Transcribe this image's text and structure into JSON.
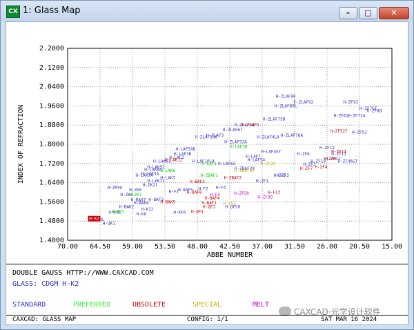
{
  "window": {
    "icon_text": "CX",
    "title": "1: Glass Map",
    "minimize_glyph": "–",
    "maximize_glyph": "□",
    "close_glyph": "✕"
  },
  "chart_data": {
    "type": "scatter",
    "xlabel": "ABBE NUMBER",
    "ylabel": "INDEX OF REFRACTION",
    "xlim": [
      70.0,
      15.0
    ],
    "ylim": [
      1.4,
      2.2
    ],
    "x_ticks": [
      "70.00",
      "64.50",
      "59.00",
      "53.50",
      "48.00",
      "42.50",
      "37.00",
      "31.50",
      "26.00",
      "20.50",
      "15.00"
    ],
    "y_ticks": [
      "2.2000",
      "2.1200",
      "2.0400",
      "1.9600",
      "1.8800",
      "1.8000",
      "1.7200",
      "1.6400",
      "1.5600",
      "1.4800",
      "1.4000"
    ],
    "grid": true,
    "series": [
      {
        "name": "STANDARD",
        "color": "#3333cc",
        "points": [
          {
            "label": "H-ZF62",
            "x": 23.6,
            "y": 1.92
          },
          {
            "label": "H-ZF72A",
            "x": 21.0,
            "y": 1.92
          },
          {
            "label": "H-ZF7GT",
            "x": 19.0,
            "y": 1.95
          },
          {
            "label": "H-ZF88",
            "x": 18.0,
            "y": 1.94
          },
          {
            "label": "E-ZLAF92",
            "x": 30.0,
            "y": 1.975
          },
          {
            "label": "H-ZLAF89L",
            "x": 33.0,
            "y": 1.96
          },
          {
            "label": "H-ZLAF75B",
            "x": 35.0,
            "y": 1.905
          },
          {
            "label": "H-ZLAF68",
            "x": 40.0,
            "y": 1.88
          },
          {
            "label": "H-ZLAF67",
            "x": 42.0,
            "y": 1.86
          },
          {
            "label": "H-ZLAF3",
            "x": 45.0,
            "y": 1.838
          },
          {
            "label": "H-ZLAF53A",
            "x": 46.5,
            "y": 1.83
          },
          {
            "label": "H-ZLAF76A",
            "x": 32.0,
            "y": 1.838
          },
          {
            "label": "H-ZLAF4LA",
            "x": 36.0,
            "y": 1.83
          },
          {
            "label": "H-ZLAF52A",
            "x": 41.5,
            "y": 1.81
          },
          {
            "label": "H-LAF4GT",
            "x": 35.5,
            "y": 1.77
          },
          {
            "label": "H-LAF7",
            "x": 38.5,
            "y": 1.75
          },
          {
            "label": "H-LAF50B",
            "x": 50.0,
            "y": 1.78
          },
          {
            "label": "H-LAF3B",
            "x": 50.5,
            "y": 1.76
          },
          {
            "label": "H-LAF2",
            "x": 51.5,
            "y": 1.745
          },
          {
            "label": "H-LAF10LA",
            "x": 47.0,
            "y": 1.73
          },
          {
            "label": "H-LAK61",
            "x": 54.0,
            "y": 1.73
          },
          {
            "label": "H-LAK52",
            "x": 55.0,
            "y": 1.705
          },
          {
            "label": "H-LAK8A",
            "x": 55.5,
            "y": 1.695
          },
          {
            "label": "H-LAK7A",
            "x": 57.0,
            "y": 1.67
          },
          {
            "label": "H-LAK5A",
            "x": 56.0,
            "y": 1.678
          },
          {
            "label": "H-LAK3",
            "x": 53.0,
            "y": 1.66
          },
          {
            "label": "H-LAK11",
            "x": 55.0,
            "y": 1.648
          },
          {
            "label": "H-LAF62",
            "x": 43.0,
            "y": 1.72
          },
          {
            "label": "H-LAF54",
            "x": 38.0,
            "y": 1.735
          },
          {
            "label": "H-BAF5",
            "x": 50.0,
            "y": 1.61
          },
          {
            "label": "H-ZBAF20",
            "x": 40.0,
            "y": 1.7
          },
          {
            "label": "H-ZF5",
            "x": 34.0,
            "y": 1.67
          },
          {
            "label": "H-ZF6",
            "x": 30.0,
            "y": 1.76
          },
          {
            "label": "H-ZF11",
            "x": 24.0,
            "y": 1.76
          },
          {
            "label": "H-ZF12",
            "x": 25.0,
            "y": 1.74
          },
          {
            "label": "H-ZF10",
            "x": 27.5,
            "y": 1.73
          },
          {
            "label": "H-ZF3",
            "x": 29.0,
            "y": 1.717
          },
          {
            "label": "H-ZF2",
            "x": 33.5,
            "y": 1.67
          },
          {
            "label": "H-ZF1",
            "x": 37.0,
            "y": 1.647
          },
          {
            "label": "H-F4",
            "x": 44.0,
            "y": 1.62
          },
          {
            "label": "H-F2",
            "x": 47.0,
            "y": 1.615
          },
          {
            "label": "H-F1",
            "x": 52.0,
            "y": 1.603
          },
          {
            "label": "H-BAF3",
            "x": 55.0,
            "y": 1.57
          },
          {
            "label": "H-BAK7",
            "x": 58.0,
            "y": 1.568
          },
          {
            "label": "H-BAK8",
            "x": 57.5,
            "y": 1.555
          },
          {
            "label": "H-BAK2",
            "x": 60.0,
            "y": 1.54
          },
          {
            "label": "H-ZK9A",
            "x": 62.0,
            "y": 1.62
          },
          {
            "label": "H-ZK3",
            "x": 60.0,
            "y": 1.59
          },
          {
            "label": "H-ZK6",
            "x": 58.5,
            "y": 1.61
          },
          {
            "label": "H-ZK21",
            "x": 56.0,
            "y": 1.63
          },
          {
            "label": "H-QK3L",
            "x": 65.0,
            "y": 1.487
          },
          {
            "label": "H-QK1",
            "x": 63.0,
            "y": 1.47
          },
          {
            "label": "H-K9L",
            "x": 62.0,
            "y": 1.516
          },
          {
            "label": "H-K12",
            "x": 56.5,
            "y": 1.53
          },
          {
            "label": "H-K8",
            "x": 57.5,
            "y": 1.51
          },
          {
            "label": "H-KF6",
            "x": 51.0,
            "y": 1.517
          },
          {
            "label": "H-QF50",
            "x": 42.0,
            "y": 1.54
          },
          {
            "label": "H-ZF52",
            "x": 20.5,
            "y": 1.85
          },
          {
            "label": "H-ZF4AGT",
            "x": 22.5,
            "y": 1.73
          },
          {
            "label": "H-ZF13",
            "x": 26.0,
            "y": 1.785
          },
          {
            "label": "H-ZLAF90",
            "x": 33.0,
            "y": 2.0
          },
          {
            "label": "H-ZF93",
            "x": 22.0,
            "y": 1.975
          }
        ]
      },
      {
        "name": "PREFERRED",
        "color": "#00cc00",
        "points": [
          {
            "label": "H-ZK7",
            "x": 58.5,
            "y": 1.59
          },
          {
            "label": "H-LAF1",
            "x": 46.0,
            "y": 1.72
          },
          {
            "label": "H-LAK6",
            "x": 53.0,
            "y": 1.69
          },
          {
            "label": "H-LAF3B",
            "x": 41.0,
            "y": 1.79
          },
          {
            "label": "H-ZBAF1",
            "x": 46.0,
            "y": 1.67
          },
          {
            "label": "H-QK3",
            "x": 61.5,
            "y": 1.52
          }
        ]
      },
      {
        "name": "OBSOLETE",
        "color": "#cc0000",
        "points": [
          {
            "label": "H-ZF52T",
            "x": 24.0,
            "y": 1.855
          },
          {
            "label": "H-ZLAF5",
            "x": 39.0,
            "y": 1.88
          },
          {
            "label": "H-LAK12",
            "x": 52.0,
            "y": 1.735
          },
          {
            "label": "H-ZBAF2",
            "x": 42.0,
            "y": 1.66
          },
          {
            "label": "H-BAF2",
            "x": 48.0,
            "y": 1.645
          },
          {
            "label": "H-BAF1",
            "x": 46.0,
            "y": 1.555
          },
          {
            "label": "H-BAF4",
            "x": 45.5,
            "y": 1.575
          },
          {
            "label": "H-BAF8",
            "x": 48.5,
            "y": 1.6
          },
          {
            "label": "H-BAK5",
            "x": 53.0,
            "y": 1.56
          },
          {
            "label": "H-ZF7",
            "x": 29.5,
            "y": 1.7
          },
          {
            "label": "H-ZF4",
            "x": 27.0,
            "y": 1.705
          },
          {
            "label": "H-ZF9",
            "x": 25.5,
            "y": 1.74
          },
          {
            "label": "H-F13",
            "x": 35.0,
            "y": 1.6
          },
          {
            "label": "H-QF1",
            "x": 48.0,
            "y": 1.52
          },
          {
            "label": "H-QF3",
            "x": 46.0,
            "y": 1.54
          },
          {
            "label": "H-ZF14",
            "x": 24.0,
            "y": 1.77
          }
        ]
      },
      {
        "name": "SPECIAL",
        "color": "#ccaa00",
        "points": [
          {
            "label": "H-ZF19",
            "x": 36.0,
            "y": 1.72
          },
          {
            "label": "H-ZBAF52",
            "x": 40.0,
            "y": 1.69
          },
          {
            "label": "H-F51",
            "x": 42.5,
            "y": 1.552
          }
        ]
      },
      {
        "name": "MELT",
        "color": "#cc00cc",
        "points": [
          {
            "label": "H-ZF50",
            "x": 40.5,
            "y": 1.595
          },
          {
            "label": "H-ZF39",
            "x": 36.5,
            "y": 1.58
          },
          {
            "label": "H-F5",
            "x": 45.0,
            "y": 1.59
          }
        ]
      }
    ],
    "highlight": {
      "label": "H-K2",
      "x": 65.5,
      "y": 1.49,
      "color": "#cc0000"
    }
  },
  "info": {
    "line1": "DOUBLE GAUSS  HTTP://WWW.CAXCAD.COM",
    "line2": "GLASS: CDGM H-K2"
  },
  "legend": [
    {
      "label": "STANDARD",
      "color": "#3333cc"
    },
    {
      "label": "PREFERRED",
      "color": "#33ee33"
    },
    {
      "label": "OBSOLETE",
      "color": "#cc0000"
    },
    {
      "label": "SPECIAL",
      "color": "#ccaa00"
    },
    {
      "label": "MELT",
      "color": "#cc00cc"
    }
  ],
  "status": {
    "left": "CAXCAD: GLASS MAP",
    "middle": "CONFIG: 1/1",
    "right": "SAT MAR 16 2024"
  },
  "watermark": "CAXCAD·光学设计软件"
}
